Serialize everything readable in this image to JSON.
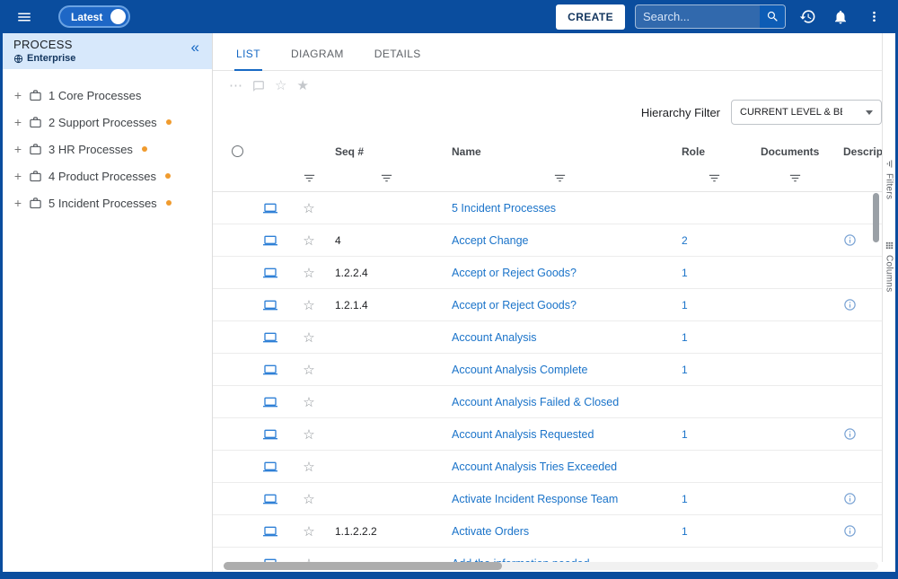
{
  "colors": {
    "topbar_blue": "#0a4d9e",
    "accent_blue": "#1769c4",
    "link_blue": "#1a73c9",
    "orange_dot": "#f09b2e",
    "sidebar_header_bg": "#d7e8fb"
  },
  "icons": {
    "star_outline": "☆",
    "star_filled": "★",
    "more_horizontal": "⋯",
    "collapse_chevrons": "«"
  },
  "topbar": {
    "latest_toggle": "Latest",
    "create_button": "CREATE",
    "search_placeholder": "Search..."
  },
  "sidebar": {
    "title": "PROCESS",
    "scope_label": "Enterprise",
    "items": [
      {
        "label": "1 Core Processes",
        "dot": false
      },
      {
        "label": "2 Support Processes",
        "dot": true
      },
      {
        "label": "3 HR Processes",
        "dot": true
      },
      {
        "label": "4 Product Processes",
        "dot": true
      },
      {
        "label": "5 Incident Processes",
        "dot": true
      }
    ]
  },
  "tabs": [
    {
      "label": "LIST",
      "active": true
    },
    {
      "label": "DIAGRAM",
      "active": false
    },
    {
      "label": "DETAILS",
      "active": false
    }
  ],
  "hierarchy_filter": {
    "label": "Hierarchy Filter",
    "value": "CURRENT LEVEL & BELOW"
  },
  "table": {
    "headers": {
      "seq": "Seq #",
      "name": "Name",
      "role": "Role",
      "documents": "Documents",
      "description": "Description"
    },
    "rows": [
      {
        "seq": "",
        "name": "5 Incident Processes",
        "role": "",
        "documents": "",
        "info": false
      },
      {
        "seq": "4",
        "name": "Accept Change",
        "role": "2",
        "documents": "",
        "info": true
      },
      {
        "seq": "1.2.2.4",
        "name": "Accept or Reject Goods?",
        "role": "1",
        "documents": "",
        "info": false
      },
      {
        "seq": "1.2.1.4",
        "name": "Accept or Reject Goods?",
        "role": "1",
        "documents": "",
        "info": true
      },
      {
        "seq": "",
        "name": "Account Analysis",
        "role": "1",
        "documents": "",
        "info": false
      },
      {
        "seq": "",
        "name": "Account Analysis Complete",
        "role": "1",
        "documents": "",
        "info": false
      },
      {
        "seq": "",
        "name": "Account Analysis Failed & Closed",
        "role": "",
        "documents": "",
        "info": false
      },
      {
        "seq": "",
        "name": "Account Analysis Requested",
        "role": "1",
        "documents": "",
        "info": true
      },
      {
        "seq": "",
        "name": "Account Analysis Tries Exceeded",
        "role": "",
        "documents": "",
        "info": false
      },
      {
        "seq": "",
        "name": "Activate Incident Response Team",
        "role": "1",
        "documents": "",
        "info": true
      },
      {
        "seq": "1.1.2.2.2",
        "name": "Activate Orders",
        "role": "1",
        "documents": "",
        "info": true
      },
      {
        "seq": "",
        "name": "Add the information needed",
        "role": "",
        "documents": "",
        "info": false
      }
    ]
  },
  "side_panels": [
    {
      "label": "Filters"
    },
    {
      "label": "Columns"
    }
  ]
}
